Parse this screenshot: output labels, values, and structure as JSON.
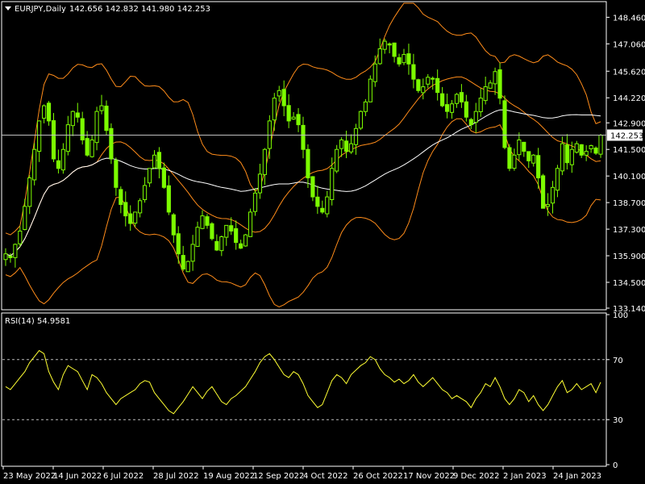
{
  "header": {
    "symbol": "EURJPY,Daily",
    "ohlc": "142.656 142.832 141.980 142.253"
  },
  "rsi_header": "RSI(14) 54.9581",
  "colors": {
    "background": "#000000",
    "frame": "#ffffff",
    "bull_candle": "#7CFC00",
    "band_lines": "#ff8c1a",
    "ma_line": "#ffffff",
    "rsi_line": "#ffff33",
    "price_line": "#c0c0c0"
  },
  "chart_data": [
    {
      "type": "line",
      "title": "EURJPY,Daily",
      "subtitle": "142.656 142.832 141.980 142.253",
      "indicators": [
        "Bollinger Bands",
        "Moving Average"
      ],
      "x_dates": [
        "23 May 2022",
        "14 Jun 2022",
        "6 Jul 2022",
        "28 Jul 2022",
        "19 Aug 2022",
        "12 Sep 2022",
        "4 Oct 2022",
        "26 Oct 2022",
        "17 Nov 2022",
        "9 Dec 2022",
        "2 Jan 2023",
        "24 Jan 2023"
      ],
      "y_ticks": [
        "148.460",
        "147.060",
        "145.620",
        "144.220",
        "142.900",
        "141.500",
        "140.100",
        "138.700",
        "137.300",
        "135.900",
        "134.500",
        "133.140"
      ],
      "ylim": [
        133.14,
        149.2
      ],
      "current_price": "142.253",
      "series": [
        {
          "values": [
            136.0,
            135.8,
            136.5,
            137.2,
            138.5,
            140.0,
            141.5,
            143.0,
            143.8,
            143.0,
            141.0,
            140.5,
            141.5,
            142.8,
            143.5,
            143.2,
            142.0,
            141.2,
            142.0,
            143.5,
            143.8,
            142.5,
            141.0,
            139.5,
            138.6,
            138.0,
            137.6,
            138.2,
            138.8,
            139.6,
            140.5,
            141.2,
            140.5,
            139.5,
            138.2,
            137.0,
            136.0,
            135.2,
            135.6,
            136.5,
            137.4,
            138.0,
            137.5,
            136.8,
            136.2,
            136.9,
            137.5,
            137.2,
            136.6,
            136.3,
            137.0,
            138.2,
            139.2,
            140.2,
            141.5,
            143.0,
            144.2,
            144.6,
            143.8,
            143.0,
            143.2,
            142.8,
            141.5,
            140.0,
            139.0,
            138.5,
            138.2,
            139.0,
            140.5,
            141.5,
            142.0,
            141.4,
            141.8,
            142.6,
            143.5,
            144.0,
            145.2,
            146.0,
            146.8,
            147.2,
            147.0,
            146.4,
            146.0,
            146.5,
            146.0,
            145.2,
            144.6,
            144.8,
            145.3,
            145.2,
            144.5,
            143.8,
            143.5,
            143.9,
            144.4,
            144.0,
            143.2,
            142.8,
            143.5,
            144.2,
            144.8,
            145.0,
            145.6,
            144.2,
            141.6,
            140.5,
            141.2,
            142.0,
            141.4,
            140.9,
            141.2,
            140.0,
            138.4,
            138.6,
            139.5,
            140.5,
            141.8,
            140.8,
            141.5,
            141.8,
            141.2,
            141.4,
            141.7,
            141.3,
            142.25
          ]
        }
      ]
    },
    {
      "type": "line",
      "title": "RSI(14) 54.9581",
      "y_ticks": [
        "100",
        "70",
        "30",
        "0"
      ],
      "ylim": [
        0,
        100
      ],
      "levels": [
        30,
        70
      ],
      "series": [
        {
          "values": [
            52,
            50,
            54,
            58,
            62,
            68,
            72,
            76,
            74,
            62,
            55,
            50,
            60,
            66,
            64,
            62,
            56,
            50,
            60,
            58,
            54,
            48,
            44,
            40,
            44,
            46,
            48,
            50,
            54,
            56,
            55,
            48,
            44,
            40,
            36,
            34,
            38,
            42,
            47,
            52,
            48,
            44,
            49,
            52,
            47,
            42,
            40,
            44,
            46,
            49,
            52,
            57,
            62,
            68,
            72,
            74,
            70,
            65,
            60,
            58,
            62,
            60,
            54,
            46,
            42,
            38,
            40,
            48,
            56,
            60,
            58,
            54,
            60,
            63,
            66,
            68,
            72,
            70,
            64,
            60,
            58,
            55,
            57,
            54,
            56,
            60,
            55,
            52,
            55,
            58,
            54,
            50,
            48,
            44,
            46,
            44,
            42,
            38,
            44,
            48,
            54,
            52,
            58,
            52,
            44,
            40,
            44,
            50,
            48,
            42,
            46,
            40,
            36,
            40,
            46,
            52,
            56,
            48,
            50,
            54,
            50,
            52,
            54,
            48,
            54.96
          ]
        }
      ]
    }
  ]
}
